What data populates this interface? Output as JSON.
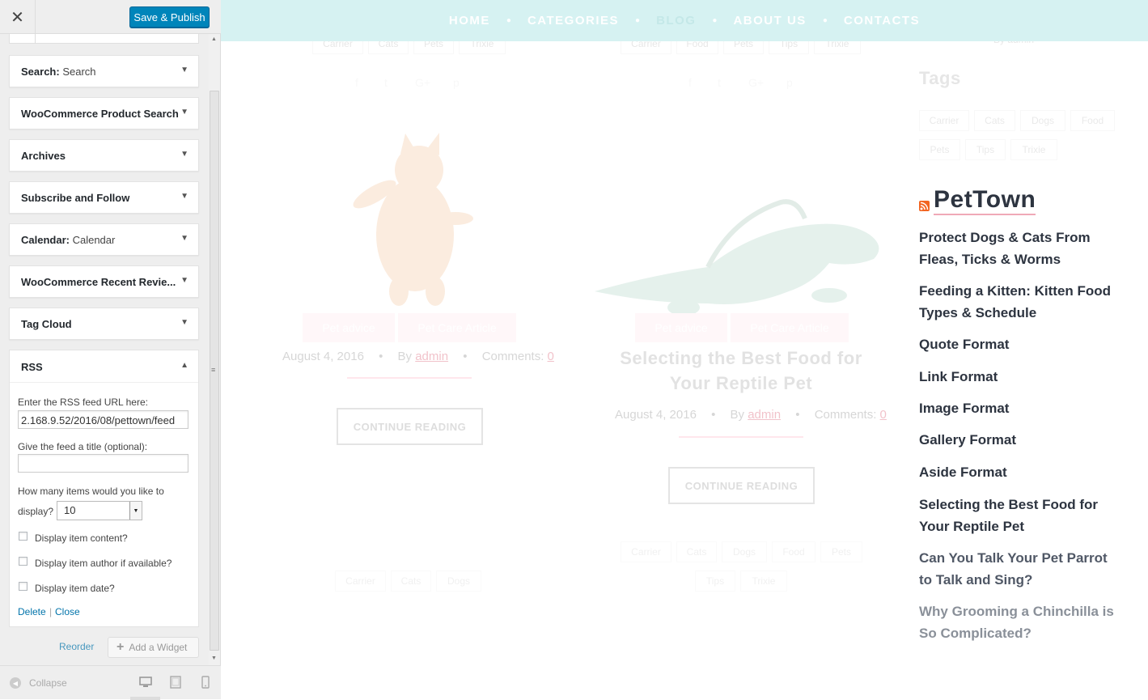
{
  "customizer": {
    "close_glyph": "✕",
    "save_label": "Save & Publish",
    "widgets": [
      {
        "title": "Search:",
        "subtitle": " Search"
      },
      {
        "title": "WooCommerce Product Search",
        "subtitle": ""
      },
      {
        "title": "Archives",
        "subtitle": ""
      },
      {
        "title": "Subscribe and Follow",
        "subtitle": ""
      },
      {
        "title": "Calendar:",
        "subtitle": " Calendar"
      },
      {
        "title": "WooCommerce Recent Revie...",
        "subtitle": ""
      },
      {
        "title": "Tag Cloud",
        "subtitle": ""
      }
    ],
    "rss_widget": {
      "title": "RSS",
      "url_label": "Enter the RSS feed URL here:",
      "url_value": "2.168.9.52/2016/08/pettown/feed",
      "title_label": "Give the feed a title (optional):",
      "title_value": "",
      "items_label_1": "How many items would you like to",
      "items_label_2": "display?",
      "items_value": "10",
      "checkboxes": [
        "Display item content?",
        "Display item author if available?",
        "Display item date?"
      ],
      "delete_label": "Delete",
      "separator": "|",
      "close_label": "Close"
    },
    "reorder_label": "Reorder",
    "add_widget_label": "Add a Widget",
    "collapse_label": "Collapse"
  },
  "preview": {
    "nav": [
      "HOME",
      "CATEGORIES",
      "BLOG",
      "ABOUT US",
      "CONTACTS"
    ],
    "top_tags_left": [
      "Carrier",
      "Cats",
      "Pets",
      "Trixie"
    ],
    "top_tags_right": [
      "Carrier",
      "Food",
      "Pets",
      "Tips",
      "Trixie"
    ],
    "post_left": {
      "categories": [
        "Pet advice",
        "Pet Care Article"
      ],
      "date": "August 4, 2016",
      "by": "By",
      "author": "admin",
      "comments": "Comments:",
      "comments_count": "0",
      "button": "CONTINUE READING"
    },
    "post_right": {
      "categories": [
        "Pet advice",
        "Pet Care Article"
      ],
      "title": "Selecting the Best Food for Your Reptile Pet",
      "date": "August 4, 2016",
      "by": "By",
      "author": "admin",
      "comments": "Comments:",
      "comments_count": "0",
      "button": "CONTINUE READING"
    },
    "bottom_tags_left": [
      "Carrier",
      "Cats",
      "Dogs"
    ],
    "bottom_tags_right": [
      "Carrier",
      "Cats",
      "Dogs",
      "Food",
      "Pets",
      "Tips",
      "Trixie"
    ],
    "sidebar": {
      "byline": "By admin",
      "tags_heading": "Tags",
      "tags": [
        "Carrier",
        "Cats",
        "Dogs",
        "Food",
        "Pets",
        "Tips",
        "Trixie"
      ],
      "rss_heading": "PetTown",
      "rss_items": [
        "Protect Dogs & Cats From Fleas, Ticks & Worms",
        "Feeding a Kitten: Kitten Food Types & Schedule",
        "Quote Format",
        "Link Format",
        "Image Format",
        "Gallery Format",
        "Aside Format",
        "Selecting the Best Food for Your Reptile Pet",
        "Can You Talk Your Pet Parrot to Talk and Sing?",
        "Why Grooming a Chinchilla is So Complicated?"
      ]
    },
    "colors": {
      "nav_bg": "#d6f2f2",
      "accent_pink": "#ffd6e1",
      "wp_blue": "#0085ba",
      "rss_orange": "#f26522"
    }
  }
}
